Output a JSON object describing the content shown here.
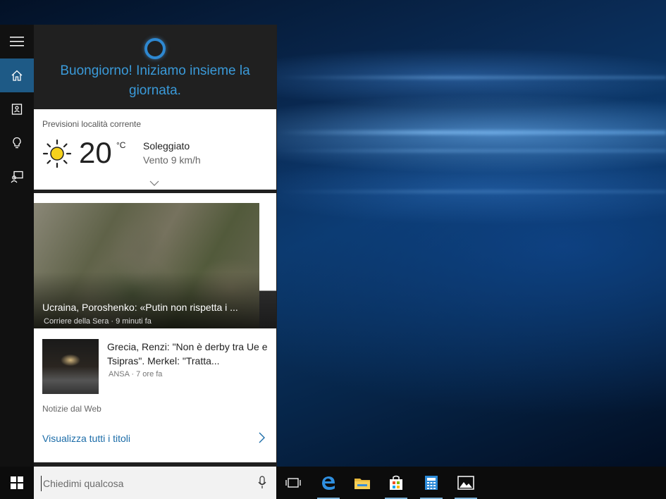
{
  "cortana": {
    "greeting": "Buongiorno! Iniziamo insieme la giornata."
  },
  "sidebar": {
    "items": [
      {
        "icon": "hamburger-menu-icon"
      },
      {
        "icon": "home-icon",
        "active": true
      },
      {
        "icon": "notebook-icon"
      },
      {
        "icon": "lightbulb-icon"
      },
      {
        "icon": "feedback-icon"
      }
    ]
  },
  "weather": {
    "title": "Previsioni località corrente",
    "temperature": "20",
    "unit": "°C",
    "condition": "Soleggiato",
    "wind": "Vento 9 km/h",
    "icon": "sun-icon"
  },
  "news": {
    "top_story": {
      "title": "Ucraina, Poroshenko: «Putin non rispetta i ...",
      "meta": "Corriere della Sera · 9 minuti fa"
    },
    "story2": {
      "title": "Grecia, Renzi: \"Non è derby tra Ue e Tsipras\". Merkel: \"Tratta...",
      "meta": "ANSA · 7 ore fa"
    },
    "source_label": "Notizie dal Web",
    "see_all": "Visualizza tutti i titoli"
  },
  "search": {
    "placeholder": "Chiedimi qualcosa"
  },
  "taskbar": {
    "apps": [
      "task-view-icon",
      "edge-icon",
      "file-explorer-icon",
      "store-icon",
      "calculator-icon",
      "photos-icon"
    ]
  },
  "colors": {
    "accent": "#3a9ad9",
    "sidebar_active": "#1e5a86",
    "link": "#1b6ca8"
  }
}
